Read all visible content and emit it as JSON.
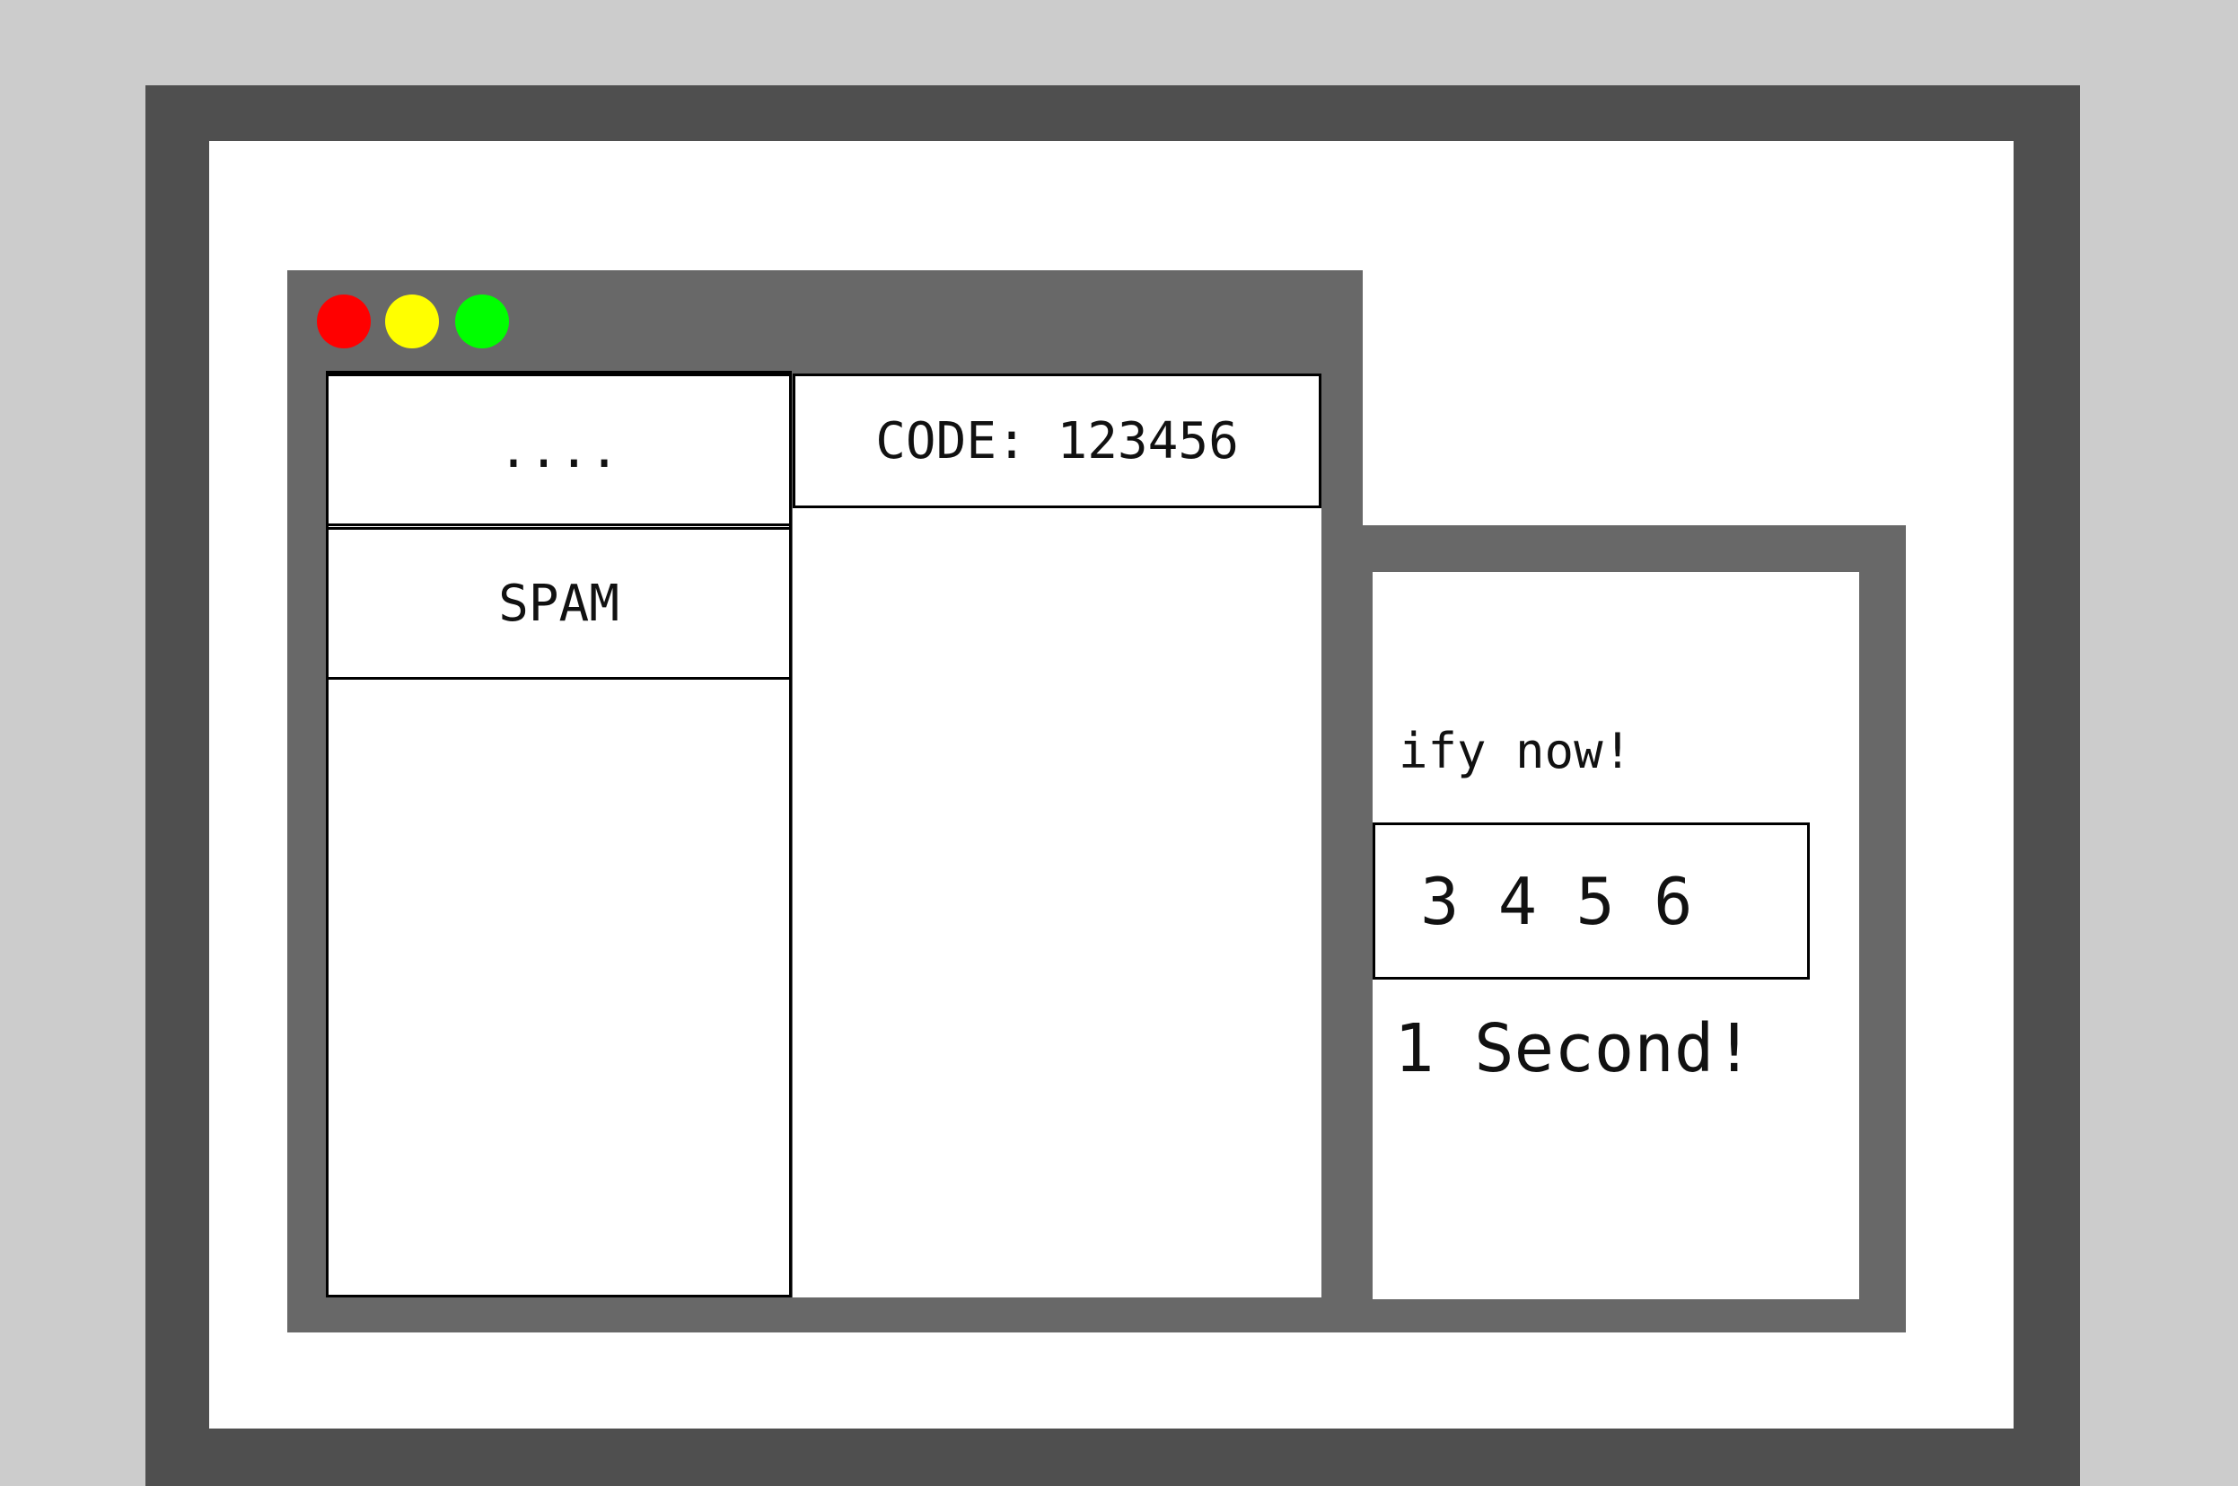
{
  "colors": {
    "close_dot": "#ff0000",
    "minimize_dot": "#ffff00",
    "maximize_dot": "#00ff00"
  },
  "mail_window": {
    "list_items": [
      {
        "label": "...."
      },
      {
        "label": "SPAM"
      }
    ],
    "reader": {
      "code_text": "CODE: 123456"
    }
  },
  "verify_window": {
    "heading": "ify now!",
    "code_input_value": "3 4 5 6",
    "timer_text": "1 Second!"
  }
}
